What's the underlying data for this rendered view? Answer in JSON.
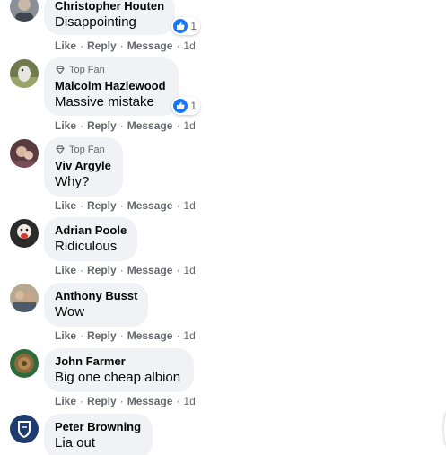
{
  "comments": [
    {
      "author": "Christopher Houten",
      "text": "Disappointing",
      "top_fan": false,
      "reaction_count": "1",
      "actions": {
        "like": "Like",
        "reply": "Reply",
        "message": "Message",
        "time": "1d"
      }
    },
    {
      "author": "Malcolm Hazlewood",
      "text": "Massive mistake",
      "top_fan": true,
      "badge": "Top Fan",
      "reaction_count": "1",
      "actions": {
        "like": "Like",
        "reply": "Reply",
        "message": "Message",
        "time": "1d"
      }
    },
    {
      "author": "Viv Argyle",
      "text": "Why?",
      "top_fan": true,
      "badge": "Top Fan",
      "actions": {
        "like": "Like",
        "reply": "Reply",
        "message": "Message",
        "time": "1d"
      }
    },
    {
      "author": "Adrian Poole",
      "text": "Ridiculous",
      "top_fan": false,
      "actions": {
        "like": "Like",
        "reply": "Reply",
        "message": "Message",
        "time": "1d"
      }
    },
    {
      "author": "Anthony Busst",
      "text": "Wow",
      "top_fan": false,
      "actions": {
        "like": "Like",
        "reply": "Reply",
        "message": "Message",
        "time": "1d"
      }
    },
    {
      "author": "John Farmer",
      "text": "Big one cheap albion",
      "top_fan": false,
      "actions": {
        "like": "Like",
        "reply": "Reply",
        "message": "Message",
        "time": "1d"
      }
    },
    {
      "author": "Peter Browning",
      "text": "Lia out",
      "top_fan": false
    }
  ],
  "separator": "·",
  "colors": {
    "bubble": "#f0f2f5",
    "meta_text": "#65676b",
    "like_blue": "#1877f2"
  },
  "icons": {
    "reaction": "like-thumb-icon",
    "top_fan": "diamond-icon"
  }
}
